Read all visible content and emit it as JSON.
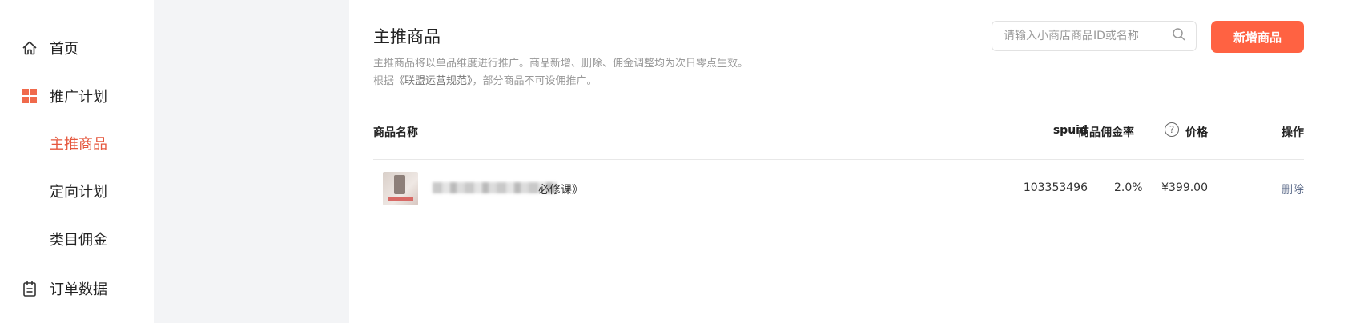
{
  "sidebar": {
    "items": [
      {
        "label": "首页",
        "icon": "home-icon"
      },
      {
        "label": "推广计划",
        "icon": "grid-icon"
      },
      {
        "label": "订单数据",
        "icon": "clipboard-icon"
      }
    ],
    "sub_items": [
      {
        "label": "主推商品",
        "active": true
      },
      {
        "label": "定向计划",
        "active": false
      },
      {
        "label": "类目佣金",
        "active": false
      }
    ]
  },
  "main": {
    "title": "主推商品",
    "desc_line1": "主推商品将以单品维度进行推广。商品新增、删除、佣金调整均为次日零点生效。",
    "desc_line2_prefix": "根据",
    "desc_line2_link": "《联盟运营规范》",
    "desc_line2_suffix": "，部分商品不可设佣推广。",
    "search_placeholder": "请输入小商店商品ID或名称",
    "add_button": "新增商品"
  },
  "table": {
    "headers": {
      "name": "商品名称",
      "spuid": "spuid",
      "price": "价格",
      "commission": "商品佣金率",
      "action": "操作"
    },
    "rows": [
      {
        "name_suffix": "必修课》",
        "spuid": "103353496",
        "price": "¥399.00",
        "commission": "2.0%",
        "action": "删除"
      }
    ]
  },
  "colors": {
    "accent": "#ff6242",
    "active_text": "#e5583e",
    "grid_icon": "#f06a4c"
  }
}
